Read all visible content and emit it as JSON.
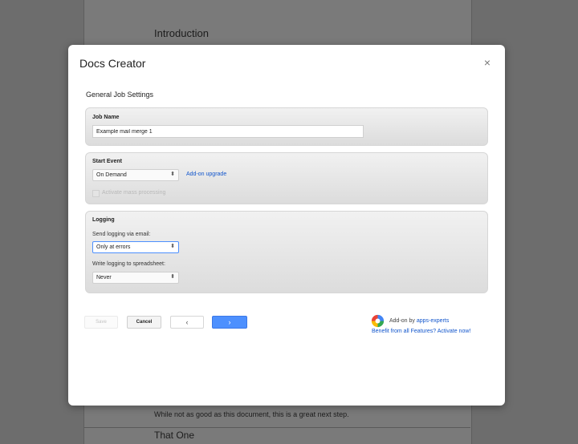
{
  "background_doc": {
    "heading": "Introduction",
    "body_text": "While not as good as this document, this is a great next step.",
    "heading2": "That One"
  },
  "dialog": {
    "title": "Docs Creator",
    "close_glyph": "×",
    "section_heading": "General Job Settings",
    "job_name": {
      "label": "Job Name",
      "value": "Example mail merge 1"
    },
    "start_event": {
      "label": "Start Event",
      "selected": "On Demand",
      "upgrade_link": "Add-on upgrade",
      "checkbox_label": "Activate mass processing",
      "checkbox_checked": false
    },
    "logging": {
      "label": "Logging",
      "email_label": "Send logging via email:",
      "email_selected": "Only at errors",
      "sheet_label": "Write logging to spreadsheet:",
      "sheet_selected": "Never"
    },
    "buttons": {
      "save": "Save",
      "cancel": "Cancel",
      "prev": "‹",
      "next": "›"
    },
    "addon": {
      "by_prefix": "Add-on by ",
      "vendor": "apps-experts",
      "promo": "Benefit from all Features? Activate now!"
    }
  },
  "colors": {
    "accent_blue": "#4d90fe",
    "link_blue": "#1155cc",
    "overlay_gray": "#6d6d6d"
  }
}
